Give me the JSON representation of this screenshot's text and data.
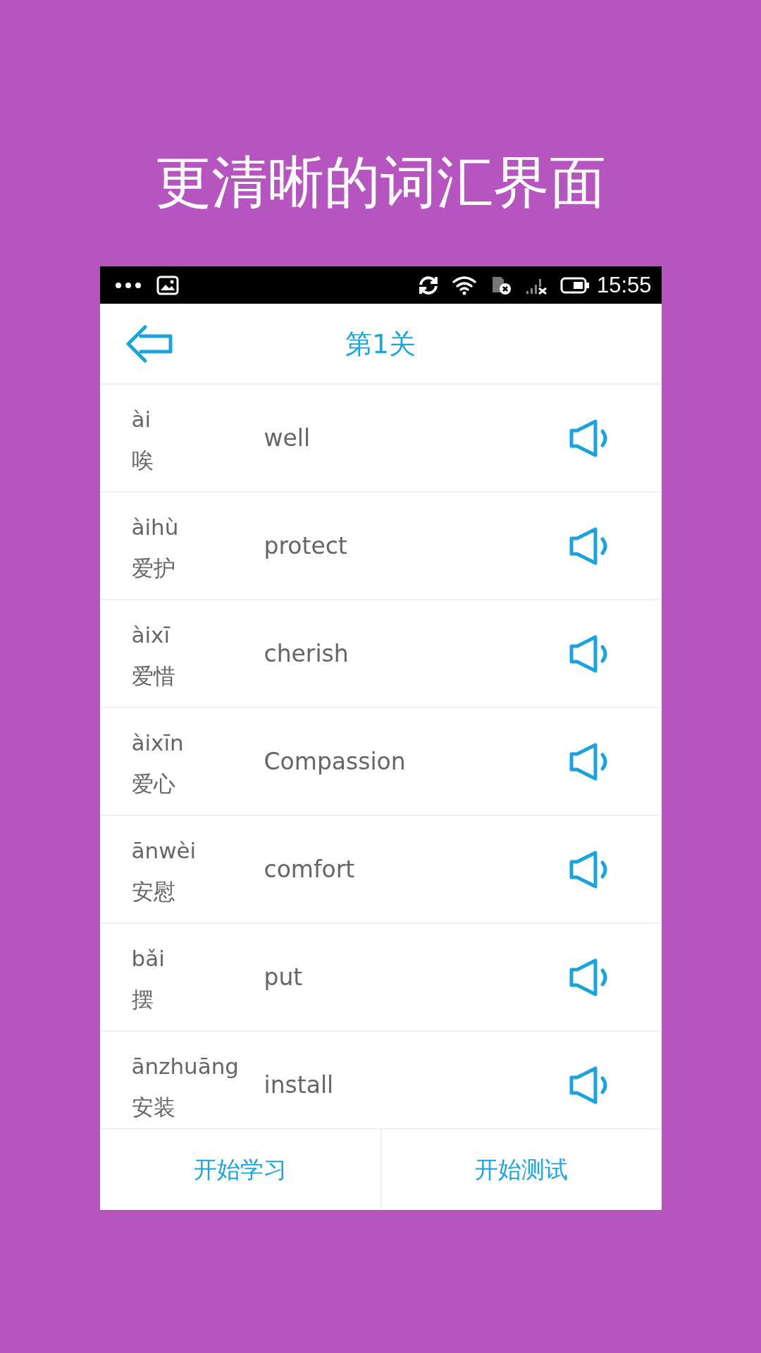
{
  "headline": "更清晰的词汇界面",
  "status_bar": {
    "time": "15:55"
  },
  "header": {
    "title": "第1关"
  },
  "words": [
    {
      "pinyin": "ài",
      "hanzi": "唉",
      "english": "well"
    },
    {
      "pinyin": "àihù",
      "hanzi": "爱护",
      "english": "protect"
    },
    {
      "pinyin": "àixī",
      "hanzi": "爱惜",
      "english": "cherish"
    },
    {
      "pinyin": "àixīn",
      "hanzi": "爱心",
      "english": "Compassion"
    },
    {
      "pinyin": "ānwèi",
      "hanzi": "安慰",
      "english": "comfort"
    },
    {
      "pinyin": "bǎi",
      "hanzi": "摆",
      "english": "put"
    },
    {
      "pinyin": "ānzhuāng",
      "hanzi": "安装",
      "english": "install"
    }
  ],
  "bottom_buttons": [
    "开始学习",
    "开始测试"
  ]
}
